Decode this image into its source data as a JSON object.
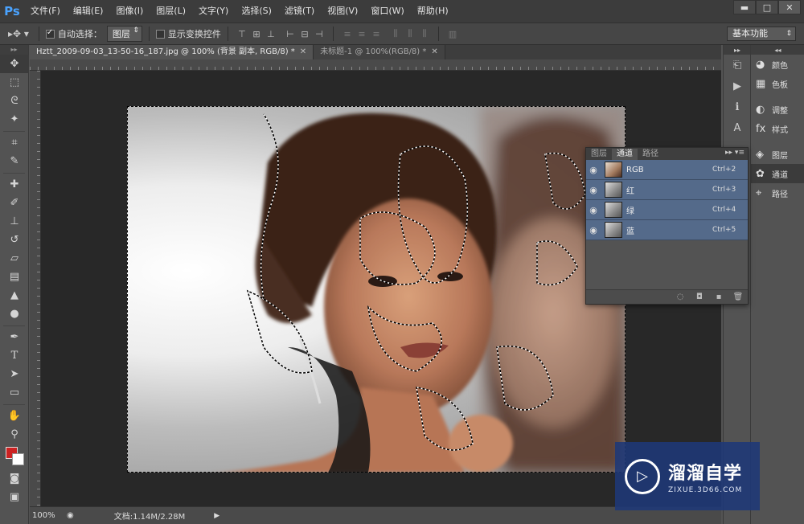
{
  "app": {
    "logo": "Ps"
  },
  "menu": [
    "文件(F)",
    "编辑(E)",
    "图像(I)",
    "图层(L)",
    "文字(Y)",
    "选择(S)",
    "滤镜(T)",
    "视图(V)",
    "窗口(W)",
    "帮助(H)"
  ],
  "window_controls": {
    "minimize": "▬",
    "maximize": "□",
    "close": "✕"
  },
  "options": {
    "auto_select_label": "自动选择：",
    "auto_select_checked": true,
    "auto_select_target": "图层",
    "show_transform_label": "显示变换控件",
    "show_transform_checked": false,
    "workspace": "基本功能"
  },
  "tabs": [
    {
      "label": "Hztt_2009-09-03_13-50-16_187.jpg @ 100% (背景 副本, RGB/8) *",
      "active": true
    },
    {
      "label": "未标题-1 @ 100%(RGB/8) *",
      "active": false
    }
  ],
  "tools": [
    "move-icon",
    "marquee-icon",
    "lasso-icon",
    "quick-select-icon",
    "crop-icon",
    "eyedropper-icon",
    "healing-icon",
    "brush-icon",
    "stamp-icon",
    "history-brush-icon",
    "eraser-icon",
    "gradient-icon",
    "blur-icon",
    "dodge-icon",
    "pen-icon",
    "type-icon",
    "path-select-icon",
    "shape-icon",
    "hand-icon",
    "zoom-icon"
  ],
  "colors": {
    "foreground": "#cc2222",
    "background": "#ffffff",
    "selection_row": "#546a8a"
  },
  "status": {
    "zoom": "100%",
    "doc": "文档:1.14M/2.28M"
  },
  "channels_panel": {
    "tabs": [
      "图层",
      "通道",
      "路径"
    ],
    "active_tab": "通道",
    "rows": [
      {
        "name": "RGB",
        "shortcut": "Ctrl+2"
      },
      {
        "name": "红",
        "shortcut": "Ctrl+3"
      },
      {
        "name": "绿",
        "shortcut": "Ctrl+4"
      },
      {
        "name": "蓝",
        "shortcut": "Ctrl+5"
      }
    ]
  },
  "dock": [
    {
      "label": "颜色",
      "icon": "color-icon"
    },
    {
      "label": "色板",
      "icon": "swatches-icon"
    },
    {
      "label": "调整",
      "icon": "adjustments-icon"
    },
    {
      "label": "样式",
      "icon": "styles-icon"
    },
    {
      "label": "图层",
      "icon": "layers-icon"
    },
    {
      "label": "通道",
      "icon": "channels-icon",
      "active": true
    },
    {
      "label": "路径",
      "icon": "paths-icon"
    }
  ],
  "watermark": {
    "title": "溜溜自学",
    "url": "ZIXUE.3D66.COM"
  }
}
